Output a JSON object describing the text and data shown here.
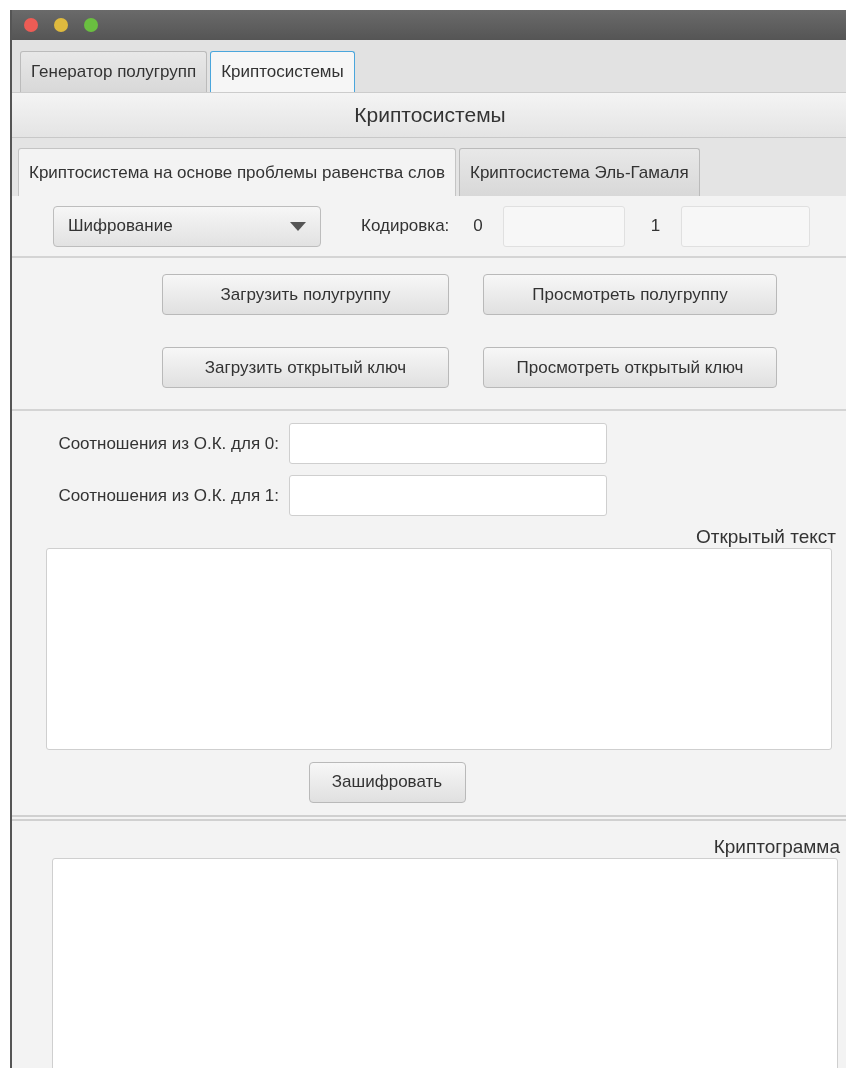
{
  "window": {
    "controls": [
      {
        "color": "#ee5c55"
      },
      {
        "color": "#dfba3e"
      },
      {
        "color": "#6abf40"
      }
    ]
  },
  "tabs": [
    {
      "label": "Генератор полугрупп",
      "selected": false
    },
    {
      "label": "Криптосистемы",
      "selected": true
    }
  ],
  "header": {
    "title": "Криптосистемы"
  },
  "inner_tabs": [
    {
      "label": "Криптосистема на основе проблемы равенства слов",
      "selected": true
    },
    {
      "label": "Криптосистема Эль-Гамаля",
      "selected": false
    }
  ],
  "mode_dropdown": {
    "value": "Шифрование"
  },
  "encoding": {
    "label": "Кодировка:",
    "fields": [
      {
        "label": "0"
      },
      {
        "label": "1"
      }
    ]
  },
  "key_buttons": [
    [
      "Загрузить полугруппу",
      "Просмотреть полугруппу"
    ],
    [
      "Загрузить открытый ключ",
      "Просмотреть открытый ключ"
    ]
  ],
  "relations": [
    {
      "label": "Соотношения из О.К. для 0:"
    },
    {
      "label": "Соотношения из О.К. для 1:"
    }
  ],
  "plaintext": {
    "label": "Открытый текст"
  },
  "encrypt_button": {
    "label": "Зашифровать"
  },
  "ciphertext": {
    "label": "Криптограмма"
  }
}
